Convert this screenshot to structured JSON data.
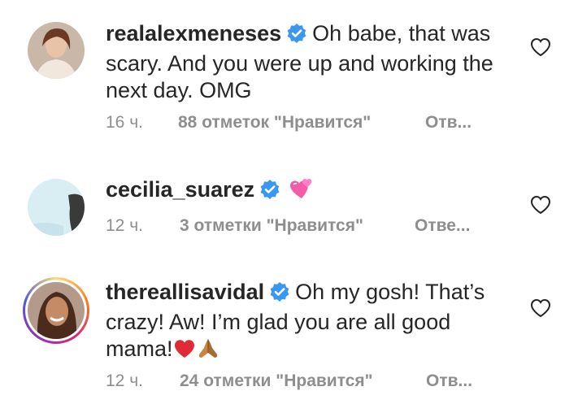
{
  "comments": [
    {
      "username": "realalexmeneses",
      "verified": true,
      "text": "Oh babe, that was scary.  And you were up and working the next day.  OMG",
      "time": "16 ч.",
      "likes": "88 отметок \"Нравится\"",
      "reply": "Отв...",
      "avatar_icon": "avatar-photo",
      "liked": false
    },
    {
      "username": "cecilia_suarez",
      "verified": true,
      "text": "",
      "emoji": "two-hearts",
      "time": "12 ч.",
      "likes": "3 отметки \"Нравится\"",
      "reply": "Отве...",
      "avatar_icon": "avatar-photo",
      "liked": false
    },
    {
      "username": "thereallisavidal",
      "verified": true,
      "text": "Oh my gosh! That’s crazy! Aw! I’m glad you are all good mama!",
      "emoji_after": [
        "red-heart",
        "folded-hands"
      ],
      "time": "12 ч.",
      "likes": "24 отметки \"Нравится\"",
      "reply": "Отв...",
      "avatar_icon": "avatar-photo",
      "has_story_ring": true,
      "liked": false
    }
  ],
  "colors": {
    "text": "#262626",
    "meta": "#8e8e8e",
    "verified": "#3897f0",
    "story_ring": "#d62976"
  }
}
